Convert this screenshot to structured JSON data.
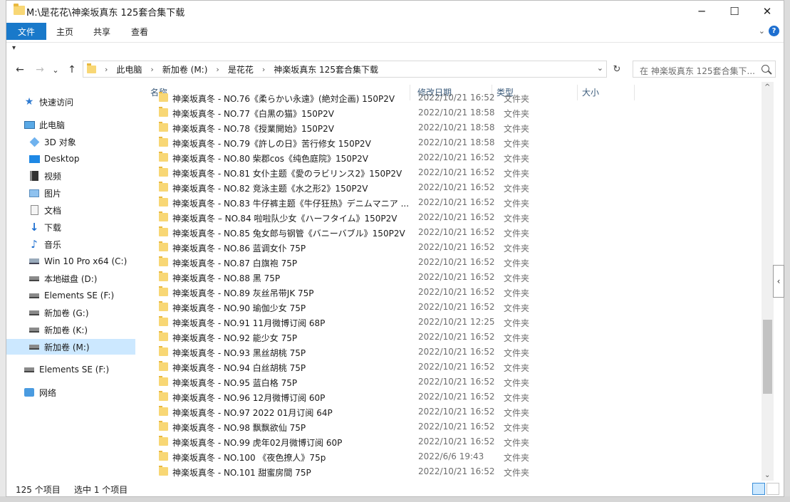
{
  "window": {
    "title": "M:\\是花花\\神楽坂真东 125套合集下载",
    "controls": {
      "minimize": "─",
      "maximize": "☐",
      "close": "✕"
    }
  },
  "ribbon": {
    "tabs": [
      "文件",
      "主页",
      "共享",
      "查看"
    ],
    "expand_glyph": "⌄",
    "help_glyph": "?"
  },
  "qat": {
    "glyph": "▾"
  },
  "nav": {
    "back": "←",
    "forward": "→",
    "recent": "⌄",
    "up": "↑",
    "breadcrumbs": [
      "此电脑",
      "新加卷 (M:)",
      "是花花",
      "神楽坂真东 125套合集下载"
    ],
    "crumb_sep": "›",
    "dropdown": "⌄",
    "refresh": "↻",
    "search_placeholder": "在 神楽坂真东 125套合集下..."
  },
  "sidebar": [
    {
      "label": "快速访问",
      "icon": "star-icon"
    },
    {
      "label": "此电脑",
      "icon": "pc-icon"
    },
    {
      "label": "3D 对象",
      "icon": "3d-objects-icon"
    },
    {
      "label": "Desktop",
      "icon": "desktop-icon"
    },
    {
      "label": "视频",
      "icon": "video-icon"
    },
    {
      "label": "图片",
      "icon": "pictures-icon"
    },
    {
      "label": "文档",
      "icon": "documents-icon"
    },
    {
      "label": "下载",
      "icon": "download-icon"
    },
    {
      "label": "音乐",
      "icon": "music-icon"
    },
    {
      "label": "Win 10 Pro x64 (C:)",
      "icon": "system-drive-icon"
    },
    {
      "label": "本地磁盘 (D:)",
      "icon": "drive-icon"
    },
    {
      "label": "Elements SE (F:)",
      "icon": "drive-icon"
    },
    {
      "label": "新加卷 (G:)",
      "icon": "drive-icon"
    },
    {
      "label": "新加卷 (K:)",
      "icon": "drive-icon"
    },
    {
      "label": "新加卷 (M:)",
      "icon": "drive-icon"
    },
    {
      "label": "Elements SE (F:)",
      "icon": "drive-icon"
    },
    {
      "label": "网络",
      "icon": "network-icon"
    }
  ],
  "columns": {
    "name": "名称",
    "date": "修改日期",
    "type": "类型",
    "size": "大小",
    "sort_glyph": "^"
  },
  "files": [
    {
      "name": "神楽坂真冬 - NO.76《柔らかい永遠》(絶対企画) 150P2V",
      "date": "2022/10/21 16:52",
      "type": "文件夹"
    },
    {
      "name": "神楽坂真冬 - NO.77《白黒の猫》150P2V",
      "date": "2022/10/21 18:58",
      "type": "文件夹"
    },
    {
      "name": "神楽坂真冬 - NO.78《授業開始》150P2V",
      "date": "2022/10/21 18:58",
      "type": "文件夹"
    },
    {
      "name": "神楽坂真冬 - NO.79《許しの日》苦行修女 150P2V",
      "date": "2022/10/21 18:58",
      "type": "文件夹"
    },
    {
      "name": "神楽坂真冬 - NO.80 柴郡cos《纯色庭院》150P2V",
      "date": "2022/10/21 16:52",
      "type": "文件夹"
    },
    {
      "name": "神楽坂真冬 - NO.81 女仆主题《愛のラビリンス2》150P2V",
      "date": "2022/10/21 16:52",
      "type": "文件夹"
    },
    {
      "name": "神楽坂真冬 - NO.82 竞泳主题《水之形2》150P2V",
      "date": "2022/10/21 16:52",
      "type": "文件夹"
    },
    {
      "name": "神楽坂真冬 - NO.83 牛仔裤主题《牛仔狂热》デニムマニア ...",
      "date": "2022/10/21 16:52",
      "type": "文件夹"
    },
    {
      "name": "神楽坂真冬 – NO.84 啦啦队少女《ハーフタイム》150P2V",
      "date": "2022/10/21 16:52",
      "type": "文件夹"
    },
    {
      "name": "神楽坂真冬 - NO.85 兔女郎与钢管《バニーバブル》150P2V",
      "date": "2022/10/21 16:52",
      "type": "文件夹"
    },
    {
      "name": "神楽坂真冬 - NO.86 蓝调女仆 75P",
      "date": "2022/10/21 16:52",
      "type": "文件夹"
    },
    {
      "name": "神楽坂真冬 - NO.87 白旗袍 75P",
      "date": "2022/10/21 16:52",
      "type": "文件夹"
    },
    {
      "name": "神楽坂真冬 - NO.88 黑 75P",
      "date": "2022/10/21 16:52",
      "type": "文件夹"
    },
    {
      "name": "神楽坂真冬 - NO.89 灰丝吊带JK 75P",
      "date": "2022/10/21 16:52",
      "type": "文件夹"
    },
    {
      "name": "神楽坂真冬 - NO.90 瑜伽少女 75P",
      "date": "2022/10/21 16:52",
      "type": "文件夹"
    },
    {
      "name": "神楽坂真冬 - NO.91 11月微博订阅 68P",
      "date": "2022/10/21 12:25",
      "type": "文件夹"
    },
    {
      "name": "神楽坂真冬 - NO.92 能少女 75P",
      "date": "2022/10/21 16:52",
      "type": "文件夹"
    },
    {
      "name": "神楽坂真冬 - NO.93 黑丝胡桃 75P",
      "date": "2022/10/21 16:52",
      "type": "文件夹"
    },
    {
      "name": "神楽坂真冬 - NO.94 白丝胡桃 75P",
      "date": "2022/10/21 16:52",
      "type": "文件夹"
    },
    {
      "name": "神楽坂真冬 - NO.95 蓝白格 75P",
      "date": "2022/10/21 16:52",
      "type": "文件夹"
    },
    {
      "name": "神楽坂真冬 - NO.96 12月微博订阅 60P",
      "date": "2022/10/21 16:52",
      "type": "文件夹"
    },
    {
      "name": "神楽坂真冬 - NO.97 2022 01月订阅 64P",
      "date": "2022/10/21 16:52",
      "type": "文件夹"
    },
    {
      "name": "神楽坂真冬 - NO.98 飘飘欲仙 75P",
      "date": "2022/10/21 16:52",
      "type": "文件夹"
    },
    {
      "name": "神楽坂真冬 - NO.99 虎年02月微博订阅 60P",
      "date": "2022/10/21 16:52",
      "type": "文件夹"
    },
    {
      "name": "神楽坂真冬 - NO.100 《夜色撩人》75p",
      "date": "2022/6/6 19:43",
      "type": "文件夹"
    },
    {
      "name": "神楽坂真冬 - NO.101 甜蜜房間 75P",
      "date": "2022/10/21 16:52",
      "type": "文件夹"
    }
  ],
  "scroll": {
    "up": "^",
    "down": "⌄",
    "pane_toggle": "‹"
  },
  "status": {
    "count": "125 个项目",
    "selected": "选中 1 个项目"
  }
}
